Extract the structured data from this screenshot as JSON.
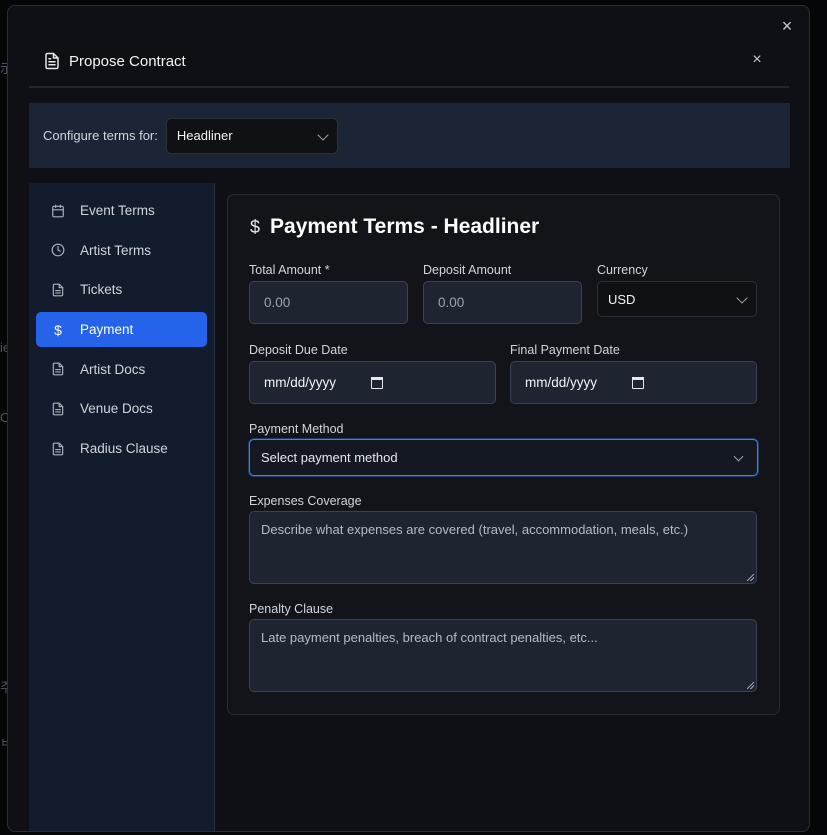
{
  "backdrop": {
    "glyphs": [
      "示",
      "ie",
      "O",
      "주",
      "ㅂ"
    ]
  },
  "modal": {
    "close_glyph": "×",
    "title": "Propose Contract",
    "header_close_glyph": "×"
  },
  "config": {
    "label": "Configure terms for:",
    "selected_role": "Headliner"
  },
  "sidebar": {
    "items": [
      {
        "label": "Event Terms",
        "icon": "calendar-icon"
      },
      {
        "label": "Artist Terms",
        "icon": "clock-icon"
      },
      {
        "label": "Tickets",
        "icon": "document-icon"
      },
      {
        "label": "Payment",
        "icon": "dollar-icon",
        "active": true
      },
      {
        "label": "Artist Docs",
        "icon": "document-icon"
      },
      {
        "label": "Venue Docs",
        "icon": "document-icon"
      },
      {
        "label": "Radius Clause",
        "icon": "document-icon"
      }
    ]
  },
  "payment": {
    "title_icon": "$",
    "title": "Payment Terms - Headliner",
    "total_amount": {
      "label": "Total Amount *",
      "placeholder": "0.00"
    },
    "deposit_amount": {
      "label": "Deposit Amount",
      "placeholder": "0.00"
    },
    "currency": {
      "label": "Currency",
      "value": "USD"
    },
    "deposit_due_date": {
      "label": "Deposit Due Date",
      "value": "mm/dd/yyyy"
    },
    "final_payment_date": {
      "label": "Final Payment Date",
      "value": "mm/dd/yyyy"
    },
    "payment_method": {
      "label": "Payment Method",
      "value": "Select payment method"
    },
    "expenses_coverage": {
      "label": "Expenses Coverage",
      "placeholder": "Describe what expenses are covered (travel, accommodation, meals, etc.)"
    },
    "penalty_clause": {
      "label": "Penalty Clause",
      "placeholder": "Late payment penalties, breach of contract penalties, etc..."
    }
  },
  "colors": {
    "accent": "#2563eb",
    "focus_ring": "#3b82f6",
    "sidebar_bg": "#131c2c",
    "config_bg": "#1c2535"
  }
}
